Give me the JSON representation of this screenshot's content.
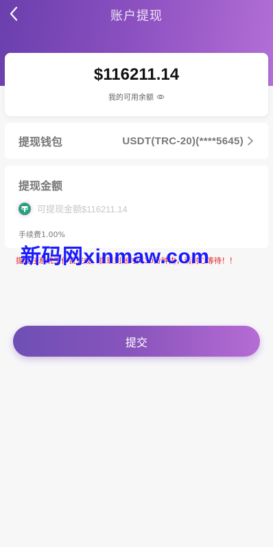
{
  "header": {
    "title": "账户提现",
    "back_icon": "chevron-left-icon"
  },
  "balance": {
    "amount": "$116211.14",
    "label": "我的可用余额",
    "visibility_icon": "eye-icon"
  },
  "wallet": {
    "label": "提现钱包",
    "value": "USDT(TRC-20)(****5645)",
    "chevron_icon": "chevron-right-icon"
  },
  "amount": {
    "title": "提现金额",
    "currency_icon": "tether-icon",
    "placeholder": "可提现金额$116211.14",
    "fee": "手续费1.00%"
  },
  "notice": "提现在系统工作日完成，提现到账时间30分钟内，请耐心等待！！",
  "watermark": "新码网xinmaw.com",
  "submit_label": "提交",
  "colors": {
    "accent": "#8a4fbf",
    "warning": "#e02020",
    "tether": "#26a17b"
  }
}
